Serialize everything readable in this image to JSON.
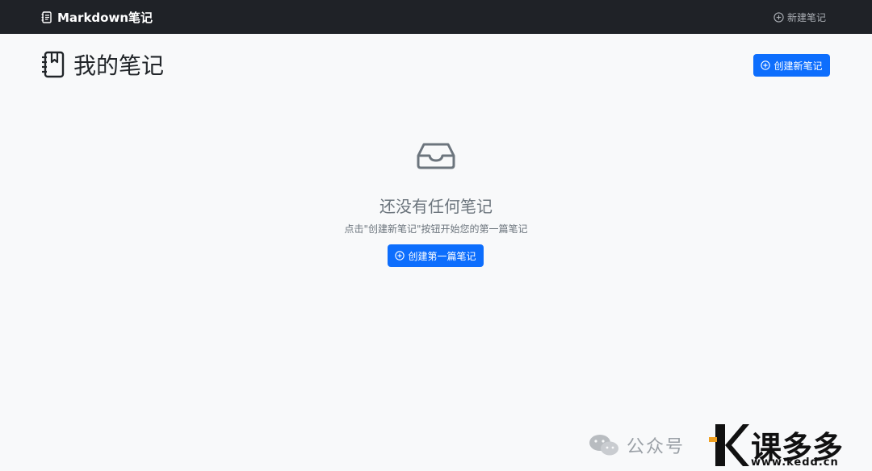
{
  "navbar": {
    "brand_label": "Markdown笔记",
    "new_note_label": "新建笔记"
  },
  "header": {
    "title": "我的笔记",
    "create_button_label": "创建新笔记"
  },
  "empty_state": {
    "title": "还没有任何笔记",
    "subtitle": "点击\"创建新笔记\"按钮开始您的第一篇笔记",
    "button_label": "创建第一篇笔记"
  },
  "watermark": {
    "public_label": "公众号",
    "brand": "课多多",
    "url": "www.kedd.cn"
  },
  "colors": {
    "navbar_bg": "#1f2227",
    "primary": "#0d6efd",
    "page_bg": "#f8f9fa",
    "muted": "#6c757d"
  },
  "icons": {
    "brand": "journal-text-icon",
    "add": "plus-circle-icon",
    "title": "journal-bookmark-icon",
    "empty": "inbox-icon"
  }
}
